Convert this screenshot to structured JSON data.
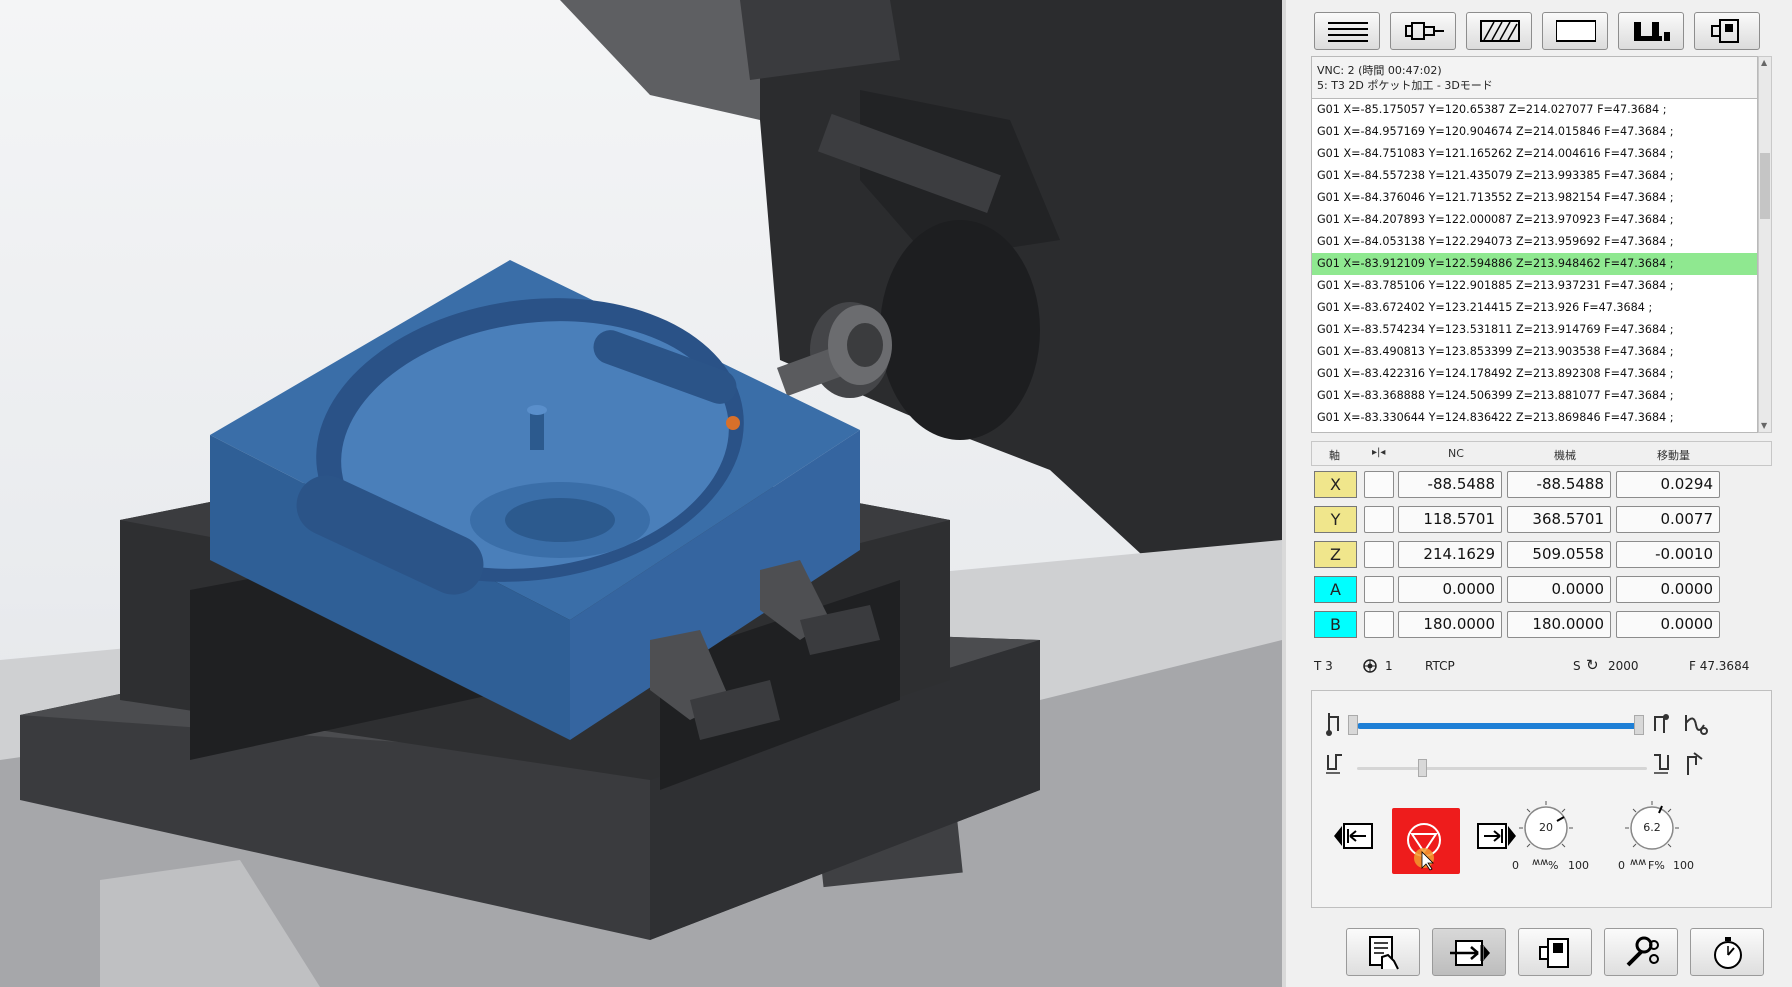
{
  "program": {
    "header_line1": "VNC: 2 (時間 00:47:02)",
    "header_line2": "5: T3 2D ポケット加工 - 3Dモード",
    "lines": [
      "G01 X=-85.175057 Y=120.65387 Z=214.027077 F=47.3684 ;",
      "G01 X=-84.957169 Y=120.904674 Z=214.015846 F=47.3684 ;",
      "G01 X=-84.751083 Y=121.165262 Z=214.004616 F=47.3684 ;",
      "G01 X=-84.557238 Y=121.435079 Z=213.993385 F=47.3684 ;",
      "G01 X=-84.376046 Y=121.713552 Z=213.982154 F=47.3684 ;",
      "G01 X=-84.207893 Y=122.000087 Z=213.970923 F=47.3684 ;",
      "G01 X=-84.053138 Y=122.294073 Z=213.959692 F=47.3684 ;",
      "G01 X=-83.912109 Y=122.594886 Z=213.948462 F=47.3684 ;",
      "G01 X=-83.785106 Y=122.901885 Z=213.937231 F=47.3684 ;",
      "G01 X=-83.672402 Y=123.214415 Z=213.926 F=47.3684 ;",
      "G01 X=-83.574234 Y=123.531811 Z=213.914769 F=47.3684 ;",
      "G01 X=-83.490813 Y=123.853399 Z=213.903538 F=47.3684 ;",
      "G01 X=-83.422316 Y=124.178492 Z=213.892308 F=47.3684 ;",
      "G01 X=-83.368888 Y=124.506399 Z=213.881077 F=47.3684 ;",
      "G01 X=-83.330644 Y=124.836422 Z=213.869846 F=47.3684 ;"
    ],
    "active_index": 7
  },
  "axes": {
    "headers": {
      "axis": "軸",
      "nc": "NC",
      "machine": "機械",
      "distance": "移動量"
    },
    "rows": [
      {
        "name": "X",
        "nc": "-88.5488",
        "machine": "-88.5488",
        "distance": "0.0294",
        "color": "#f0e68c"
      },
      {
        "name": "Y",
        "nc": "118.5701",
        "machine": "368.5701",
        "distance": "0.0077",
        "color": "#f0e68c"
      },
      {
        "name": "Z",
        "nc": "214.1629",
        "machine": "509.0558",
        "distance": "-0.0010",
        "color": "#f0e68c"
      },
      {
        "name": "A",
        "nc": "0.0000",
        "machine": "0.0000",
        "distance": "0.0000",
        "color": "#00ffff"
      },
      {
        "name": "B",
        "nc": "180.0000",
        "machine": "180.0000",
        "distance": "0.0000",
        "color": "#00ffff"
      }
    ]
  },
  "status": {
    "tool": "T 3",
    "work_offset": "1",
    "rtcp": "RTCP",
    "spindle_label": "S",
    "spindle_value": "2000",
    "feed": "F  47.3684"
  },
  "controls": {
    "progress": 1.0,
    "knob1": {
      "value": "20",
      "min": "0",
      "max": "100",
      "unit": "%"
    },
    "knob2": {
      "value": "6.2",
      "min": "0",
      "max": "100",
      "unit": "F%"
    },
    "accent_blue": "#1e7fd6",
    "stop_red": "#ee1c1c"
  }
}
